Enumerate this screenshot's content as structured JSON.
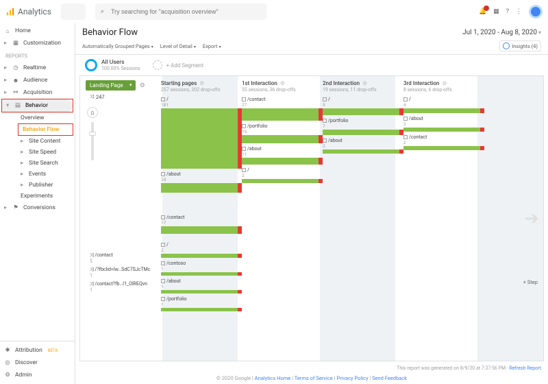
{
  "app": "Analytics",
  "search_placeholder": "Try searching for \"acquisition overview\"",
  "date_range": "Jul 1, 2020 - Aug 8, 2020",
  "insights_label": "Insights (4)",
  "sidebar": {
    "home": "Home",
    "customization": "Customization",
    "section": "REPORTS",
    "realtime": "Realtime",
    "audience": "Audience",
    "acquisition": "Acquisition",
    "behavior": "Behavior",
    "behavior_children": {
      "overview": "Overview",
      "behavior_flow": "Behavior Flow",
      "site_content": "Site Content",
      "site_speed": "Site Speed",
      "site_search": "Site Search",
      "events": "Events",
      "publisher": "Publisher",
      "experiments": "Experiments"
    },
    "conversions": "Conversions",
    "attribution": "Attribution",
    "beta": "BETA",
    "discover": "Discover",
    "admin": "Admin"
  },
  "title": "Behavior Flow",
  "controls": {
    "group": "Automatically Grouped Pages",
    "lod": "Level of Detail",
    "export": "Export"
  },
  "segment": {
    "name": "All Users",
    "detail": "100.00% Sessions",
    "add": "+ Add Segment"
  },
  "flow": {
    "landing_page_btn": "Landing Page",
    "total": "247",
    "sources": [
      {
        "label": "/contact",
        "v": "5"
      },
      {
        "label": "/?fbclid=Iw…SdC7SJcTMc",
        "v": "1"
      },
      {
        "label": "/contact?fb…I1_OlREQvn",
        "v": "1"
      }
    ],
    "stages": [
      {
        "title": "Starting pages",
        "sub": "257 sessions, 202 drop-offs",
        "nodes": [
          {
            "label": "/",
            "v": "181",
            "h": 88
          },
          {
            "label": "/about",
            "v": "24",
            "h": 14
          },
          {
            "label": "/contact",
            "v": "17",
            "h": 11
          },
          {
            "label": "/",
            "v": "2",
            "h": 6
          },
          {
            "label": "/contoso",
            "v": "1",
            "h": 5
          },
          {
            "label": "/about",
            "v": "1",
            "h": 5
          },
          {
            "label": "/portfolio",
            "v": "1",
            "h": 5
          }
        ]
      },
      {
        "title": "1st Interaction",
        "sub": "55 sessions, 36 drop-offs",
        "nodes": [
          {
            "label": "/contact",
            "v": "27",
            "h": 18
          },
          {
            "label": "/portfolio",
            "v": "15",
            "h": 12
          },
          {
            "label": "/about",
            "v": "11",
            "h": 10
          },
          {
            "label": "/",
            "v": "2",
            "h": 6
          }
        ]
      },
      {
        "title": "2nd Interaction",
        "sub": "19 sessions, 11 drop-offs",
        "nodes": [
          {
            "label": "/",
            "v": "9",
            "h": 10
          },
          {
            "label": "/portfolio",
            "v": "7",
            "h": 8
          },
          {
            "label": "/about",
            "v": "2",
            "h": 6
          }
        ]
      },
      {
        "title": "3rd Interaction",
        "sub": "8 sessions, 6 drop-offs",
        "nodes": [
          {
            "label": "/",
            "v": "4",
            "h": 7
          },
          {
            "label": "/about",
            "v": "2",
            "h": 6
          },
          {
            "label": "/contact",
            "v": "2",
            "h": 6
          }
        ]
      }
    ],
    "step_link": "+ Step"
  },
  "generated": "This report was generated on 8/9/20 at 7:37:56 PM - ",
  "refresh": "Refresh Report",
  "footer": {
    "prefix": "© 2020 Google | ",
    "l1": "Analytics Home",
    "l2": "Terms of Service",
    "l3": "Privacy Policy",
    "l4": "Send Feedback"
  }
}
